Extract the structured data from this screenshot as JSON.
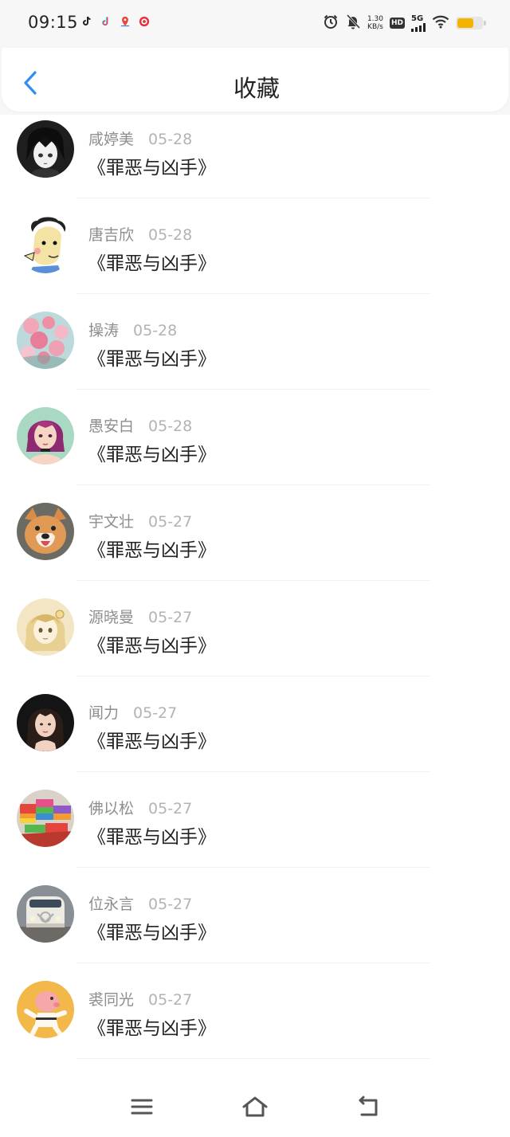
{
  "status_bar": {
    "time": "09:15",
    "app_icons": [
      "tiktok-icon",
      "tiktok-icon",
      "map-pin-icon",
      "app-red-icon"
    ],
    "net_speed_value": "1.30",
    "net_speed_unit": "KB/s",
    "hd_label": "HD",
    "network_label": "5G",
    "battery_color": "#f5b301"
  },
  "header": {
    "back_icon": "chevron-left-icon",
    "title": "收藏",
    "accent_color": "#2f8ff0"
  },
  "favorites": [
    {
      "user": "咸婷美",
      "date": "05-28",
      "title": "《罪恶与凶手》"
    },
    {
      "user": "唐吉欣",
      "date": "05-28",
      "title": "《罪恶与凶手》"
    },
    {
      "user": "操涛",
      "date": "05-28",
      "title": "《罪恶与凶手》"
    },
    {
      "user": "愚安白",
      "date": "05-28",
      "title": "《罪恶与凶手》"
    },
    {
      "user": "宇文壮",
      "date": "05-27",
      "title": "《罪恶与凶手》"
    },
    {
      "user": "源晓曼",
      "date": "05-27",
      "title": "《罪恶与凶手》"
    },
    {
      "user": "闻力",
      "date": "05-27",
      "title": "《罪恶与凶手》"
    },
    {
      "user": "佛以松",
      "date": "05-27",
      "title": "《罪恶与凶手》"
    },
    {
      "user": "位永言",
      "date": "05-27",
      "title": "《罪恶与凶手》"
    },
    {
      "user": "裘同光",
      "date": "05-27",
      "title": "《罪恶与凶手》"
    }
  ],
  "nav_bar": {
    "icons": [
      "menu-icon",
      "home-icon",
      "back-icon"
    ]
  }
}
